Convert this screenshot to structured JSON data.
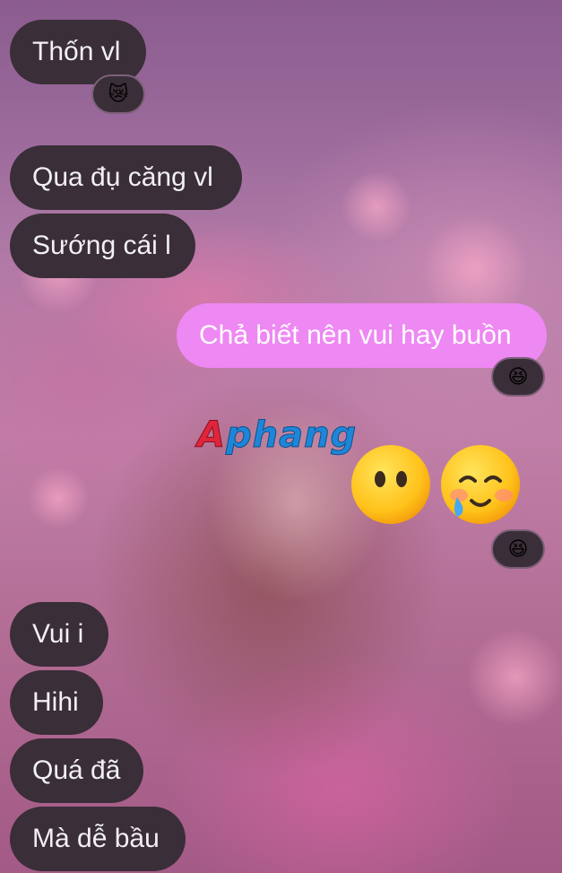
{
  "messages": [
    {
      "text": "Thốn vl",
      "side": "in"
    },
    {
      "text": "Qua đụ căng vl",
      "side": "in"
    },
    {
      "text": "Sướng cái l",
      "side": "in"
    },
    {
      "text": "Chả biết nên vui hay buồn",
      "side": "out"
    },
    {
      "text": "Vui i",
      "side": "in"
    },
    {
      "text": "Hihi",
      "side": "in"
    },
    {
      "text": "Quá đã",
      "side": "in"
    },
    {
      "text": "Mà dễ bầu",
      "side": "in"
    }
  ],
  "reactions": {
    "thon": "😿",
    "cha_biet": "😆",
    "emoji_msg": "😆"
  },
  "emoji_message": [
    "no-mouth-face-emoji",
    "face-holding-back-tears-emoji"
  ],
  "watermark": {
    "first": "A",
    "rest": "phang"
  },
  "colors": {
    "incoming_bubble": "#3a2e38",
    "outgoing_bubble": "#ee88f3",
    "text": "#f2f0f2"
  }
}
